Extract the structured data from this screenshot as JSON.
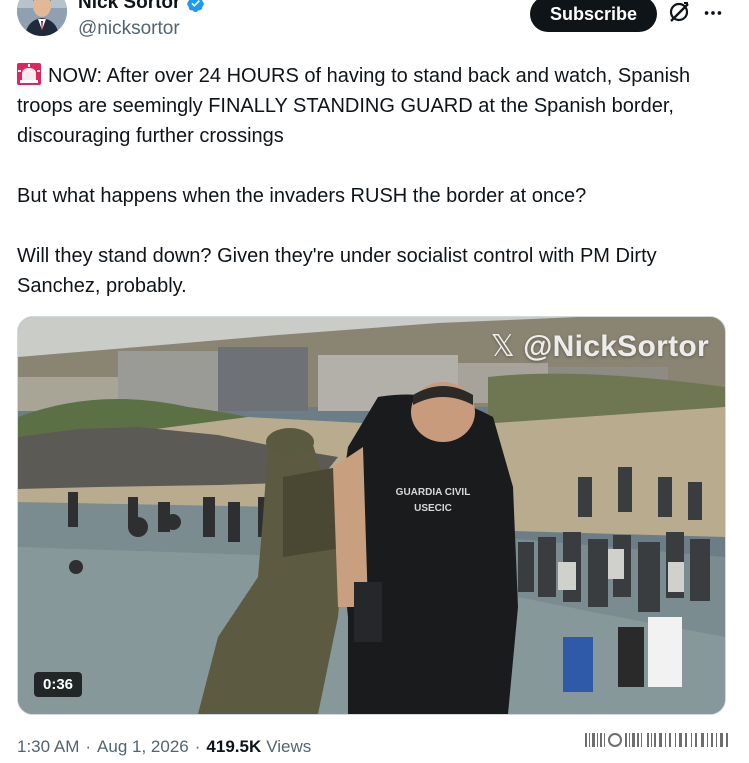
{
  "author": {
    "name": "Nick Sortor",
    "handle": "@nicksortor",
    "verified": true
  },
  "actions": {
    "subscribe_label": "Subscribe",
    "grok_icon": "grok-icon",
    "more_icon": "more-icon"
  },
  "tweet": {
    "emoji": "rotating-light-icon",
    "paragraph1": "NOW: After over 24 HOURS of having to stand back and watch, Spanish troops are seemingly FINALLY STANDING GUARD at the Spanish border, discouraging further crossings",
    "paragraph2": "But what happens when the invaders RUSH the border at once?",
    "paragraph3": "Will they stand down? Given they're under socialist control with PM Dirty Sanchez, probably."
  },
  "media": {
    "watermark_x": "𝕏",
    "watermark": "@NickSortor",
    "duration": "0:36",
    "vest_text_line1": "GUARDIA CIVIL",
    "vest_text_line2": "USECIC"
  },
  "footer": {
    "time": "1:30 AM",
    "date": "Aug 1, 2026",
    "views_count": "419.5K",
    "views_label": "Views"
  },
  "colors": {
    "text": "#0f1419",
    "secondary": "#536471",
    "verified": "#1d9bf0",
    "button": "#0f1419"
  }
}
